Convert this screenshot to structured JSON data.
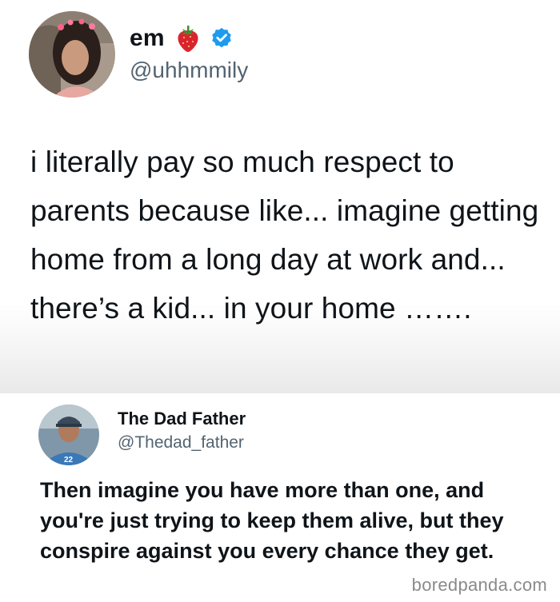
{
  "tweet1": {
    "name": "em",
    "name_emoji": "strawberry-icon",
    "verified": true,
    "handle": "@uhhmmily",
    "text": "i literally pay so much respect to parents because like... imagine getting home from a long day at work and... there’s a kid... in your home ……."
  },
  "tweet2": {
    "name": "The Dad Father",
    "handle": "@Thedad_father",
    "text": "Then imagine you have more than one, and you're just trying to keep them alive, but they conspire against you every chance they get."
  },
  "watermark": "boredpanda.com",
  "colors": {
    "text": "#0f1419",
    "secondary": "#536471",
    "verified_blue": "#1d9bf0",
    "watermark": "#8a8a8a"
  }
}
